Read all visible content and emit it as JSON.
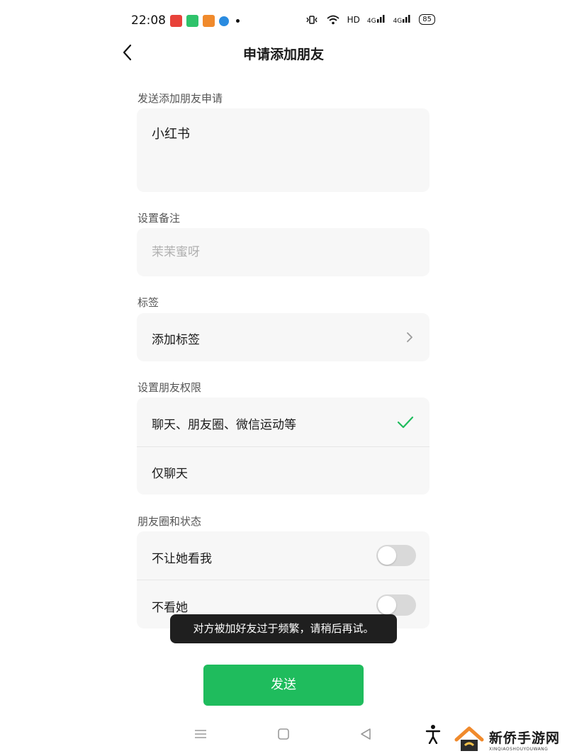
{
  "status_bar": {
    "time": "22:08",
    "network": "HD",
    "signal1": "4G",
    "signal2": "4G",
    "battery": "85"
  },
  "header": {
    "title": "申请添加朋友"
  },
  "request_message": {
    "label": "发送添加朋友申请",
    "value": "小红书"
  },
  "remark": {
    "label": "设置备注",
    "value": "",
    "placeholder": "茉茉蜜呀"
  },
  "tags": {
    "label": "标签",
    "add_label": "添加标签"
  },
  "permissions": {
    "label": "设置朋友权限",
    "options": [
      {
        "label": "聊天、朋友圈、微信运动等",
        "selected": true
      },
      {
        "label": "仅聊天",
        "selected": false
      }
    ]
  },
  "moments": {
    "label": "朋友圈和状态",
    "options": [
      {
        "label": "不让她看我",
        "on": false
      },
      {
        "label": "不看她",
        "on": false
      }
    ]
  },
  "toast": {
    "message": "对方被加好友过于频繁，请稍后再试。"
  },
  "send_button": {
    "label": "发送"
  },
  "watermark": {
    "title": "新侨手游网",
    "subtitle": "XINQIAOSHOUYOUWANG"
  },
  "colors": {
    "accent_green": "#1fbc5d",
    "card_bg": "#f7f7f7",
    "toast_bg": "#1f1f1f"
  }
}
